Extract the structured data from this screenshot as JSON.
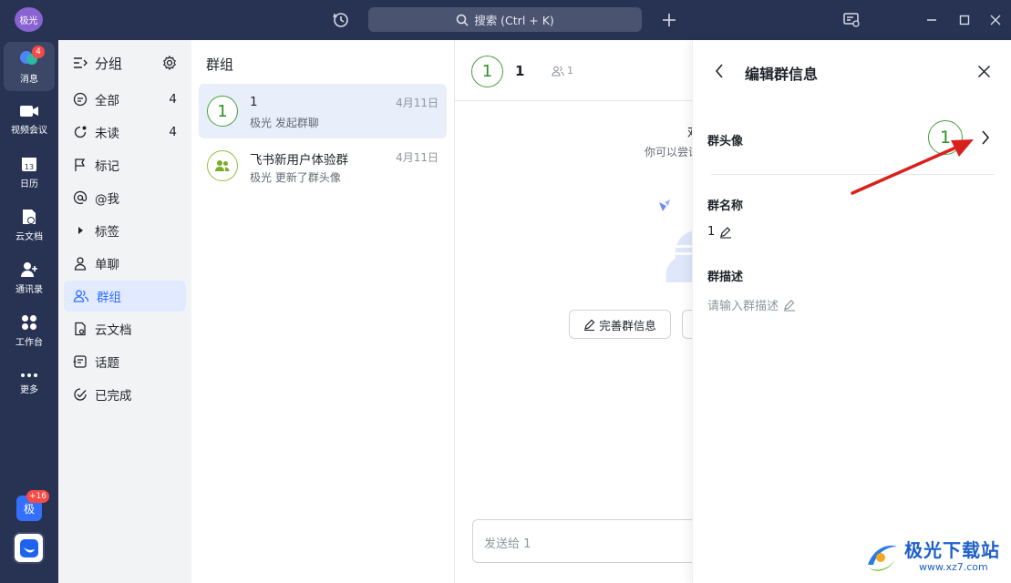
{
  "titlebar": {
    "user_avatar": "极光",
    "search_placeholder": "搜索 (Ctrl + K)"
  },
  "rail": {
    "items": [
      {
        "label": "消息",
        "icon": "chat-bubbles-icon",
        "badge": "4"
      },
      {
        "label": "视频会议",
        "icon": "video-camera-icon"
      },
      {
        "label": "日历",
        "icon": "calendar-icon",
        "day": "13"
      },
      {
        "label": "云文档",
        "icon": "cloud-doc-icon"
      },
      {
        "label": "通讯录",
        "icon": "contacts-icon"
      },
      {
        "label": "工作台",
        "icon": "workspace-icon"
      },
      {
        "label": "更多",
        "icon": "more-dots-icon"
      }
    ],
    "app_badge": "+16",
    "app_label": "极"
  },
  "groups": {
    "title": "分组",
    "items": [
      {
        "label": "全部",
        "count": "4",
        "icon": "chat-icon"
      },
      {
        "label": "未读",
        "count": "4",
        "icon": "unread-icon"
      },
      {
        "label": "标记",
        "icon": "flag-icon"
      },
      {
        "label": "@我",
        "icon": "at-icon"
      },
      {
        "label": "标签",
        "icon": "caret-right-icon"
      },
      {
        "label": "单聊",
        "icon": "person-icon"
      },
      {
        "label": "群组",
        "icon": "group-icon"
      },
      {
        "label": "云文档",
        "icon": "doc-icon"
      },
      {
        "label": "话题",
        "icon": "topic-icon"
      },
      {
        "label": "已完成",
        "icon": "check-circle-icon"
      }
    ]
  },
  "chatlist": {
    "title": "群组",
    "chats": [
      {
        "avatar": "1",
        "name": "1",
        "subtitle": "极光 发起群聊",
        "date": "4月11日"
      },
      {
        "name": "飞书新用户体验群",
        "subtitle": "极光 更新了群头像",
        "date": "4月11日"
      }
    ]
  },
  "conversation": {
    "avatar": "1",
    "name": "1",
    "member_count": "1",
    "empty_title": "邓",
    "empty_subtitle": "你可以尝试",
    "complete_button": "完善群信息",
    "input_placeholder": "发送给 1"
  },
  "edit_panel": {
    "title": "编辑群信息",
    "avatar_label": "群头像",
    "avatar_value": "1",
    "name_label": "群名称",
    "name_value": "1",
    "desc_label": "群描述",
    "desc_placeholder": "请输入群描述"
  },
  "watermark": {
    "brand": "极光下载站",
    "url": "www.xz7.com"
  },
  "colors": {
    "titlebar": "#283354",
    "accent": "#3370ff",
    "group_green": "#47a03a",
    "badge_red": "#f54a45",
    "annotation_arrow": "#d9201c"
  }
}
